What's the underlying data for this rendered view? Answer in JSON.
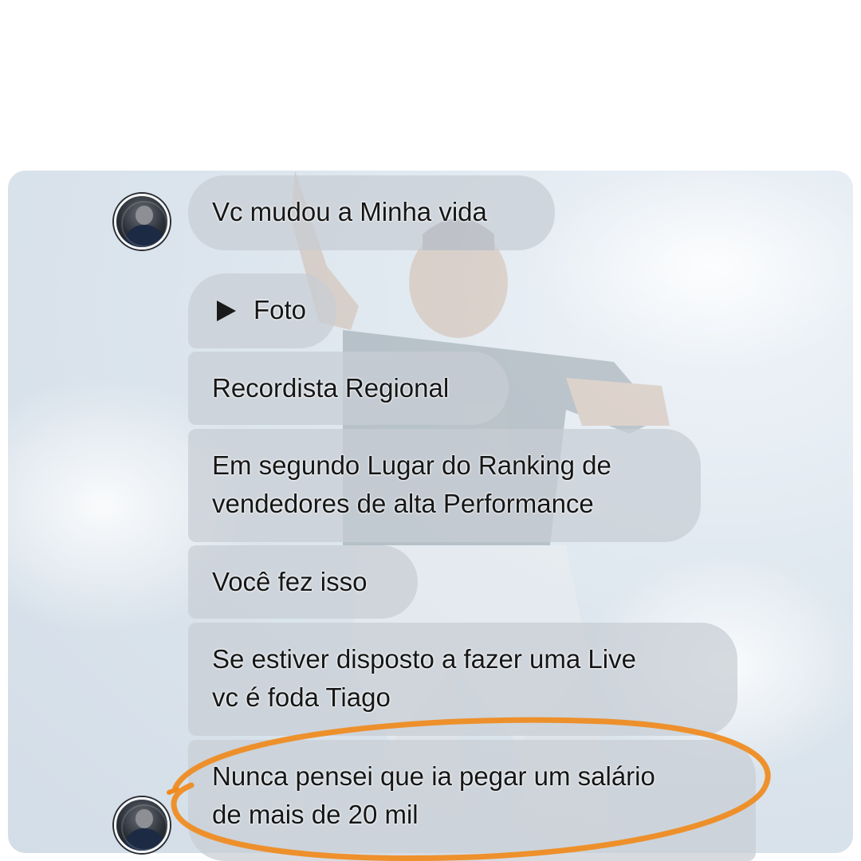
{
  "conversation": {
    "messages": [
      {
        "type": "text",
        "lines": [
          "Vc mudou a Minha vida"
        ]
      },
      {
        "type": "media",
        "icon": "play-icon",
        "label": "Foto"
      },
      {
        "type": "text",
        "lines": [
          "Recordista Regional"
        ]
      },
      {
        "type": "text",
        "lines": [
          "Em segundo Lugar do Ranking de",
          "vendedores de alta Performance"
        ]
      },
      {
        "type": "text",
        "lines": [
          "Você fez isso"
        ]
      },
      {
        "type": "text",
        "lines": [
          "Se estiver disposto a fazer uma Live",
          "vc é foda Tiago"
        ]
      },
      {
        "type": "text",
        "lines": [
          "Nunca pensei que ia pegar um salário",
          "de mais de 20 mil"
        ],
        "highlighted": true
      }
    ]
  },
  "colors": {
    "bubble": "#c8cdd4",
    "text": "#161616",
    "highlight": "#f08a1c",
    "page": "#ffffff"
  },
  "icons": [
    "avatar",
    "play-icon"
  ]
}
